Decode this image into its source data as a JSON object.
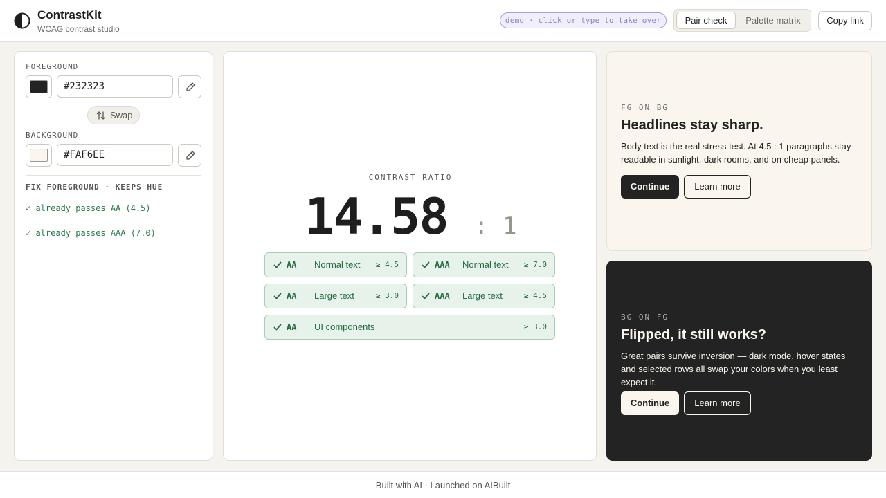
{
  "header": {
    "title": "ContrastKit",
    "subtitle": "WCAG contrast studio",
    "demo_pill": "demo · click or type to take over",
    "tabs": [
      {
        "label": "Pair check",
        "active": true
      },
      {
        "label": "Palette matrix",
        "active": false
      }
    ],
    "copy_link": "Copy link"
  },
  "left_panel": {
    "foreground_label": "FOREGROUND",
    "foreground_value": "#232323",
    "swap_label": "Swap",
    "background_label": "BACKGROUND",
    "background_value": "#FAF6EE",
    "fix_heading": "FIX FOREGROUND · KEEPS HUE",
    "fix_lines": [
      "✓ already passes AA (4.5)",
      "✓ already passes AAA (7.0)"
    ]
  },
  "center_panel": {
    "ratio_label": "CONTRAST RATIO",
    "ratio_value": "14.58",
    "ratio_suffix": ": 1",
    "checks": [
      {
        "level": "AA",
        "label": "Normal text",
        "threshold": "≥ 4.5"
      },
      {
        "level": "AAA",
        "label": "Normal text",
        "threshold": "≥ 7.0"
      },
      {
        "level": "AA",
        "label": "Large text",
        "threshold": "≥ 3.0"
      },
      {
        "level": "AAA",
        "label": "Large text",
        "threshold": "≥ 4.5"
      },
      {
        "level": "AA",
        "label": "UI components",
        "threshold": "≥ 3.0"
      }
    ]
  },
  "previews": {
    "light": {
      "label": "FG ON BG",
      "title": "Headlines stay sharp.",
      "body": "Body text is the real stress test. At 4.5 : 1 paragraphs stay readable in sunlight, dark rooms, and on cheap panels.",
      "primary": "Continue",
      "secondary": "Learn more"
    },
    "dark": {
      "label": "BG ON FG",
      "title": "Flipped, it still works?",
      "body": "Great pairs survive inversion — dark mode, hover states and selected rows all swap your colors when you least expect it.",
      "primary": "Continue",
      "secondary": "Learn more"
    }
  },
  "footer": {
    "text": "Built with AI · Launched on AIBuilt"
  },
  "colors": {
    "foreground": "#232323",
    "background": "#FAF6EE",
    "pass_green": "#256b43",
    "accent_purple": "#8c80c9"
  },
  "icons": [
    "contrast-logo-icon",
    "eyedropper-icon",
    "swap-icon",
    "check-icon"
  ]
}
